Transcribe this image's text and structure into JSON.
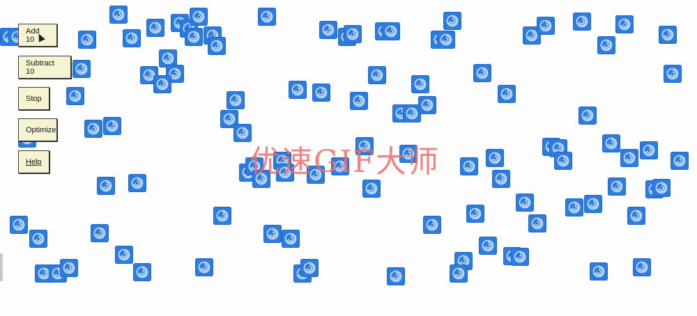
{
  "controls": {
    "add_label": "Add 10",
    "subtract_label": "Subtract 10",
    "stop_label": "Stop",
    "optimize_label": "Optimize",
    "help_label": "Help"
  },
  "watermark": "优速GIF大师",
  "sprite_icon": "swirl-logo-icon",
  "colors": {
    "sprite": "#2d7de0",
    "button_bg": "#f6f3d2",
    "watermark": "#ec6c6c"
  }
}
